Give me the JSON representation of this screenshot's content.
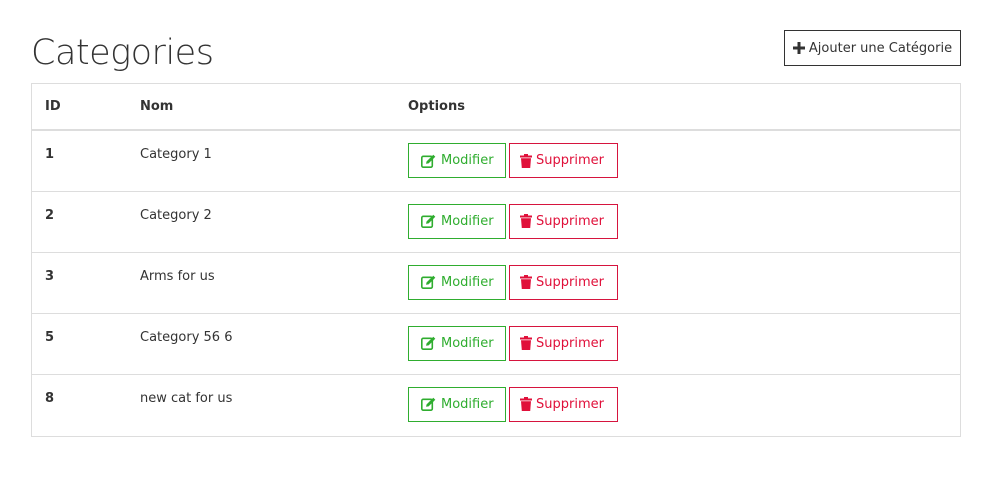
{
  "page": {
    "title": "Categories"
  },
  "toolbar": {
    "add_label": "Ajouter une Catégorie",
    "add_icon": "plus-icon"
  },
  "table": {
    "columns": [
      "ID",
      "Nom",
      "Options"
    ],
    "rows": [
      {
        "id": "1",
        "name": "Category 1"
      },
      {
        "id": "2",
        "name": "Category 2"
      },
      {
        "id": "3",
        "name": "Arms for us"
      },
      {
        "id": "5",
        "name": "Category 56 6"
      },
      {
        "id": "8",
        "name": "new cat for us"
      }
    ],
    "edit_label": "Modifier",
    "edit_icon": "edit-icon",
    "delete_label": "Supprimer",
    "delete_icon": "trash-icon"
  },
  "colors": {
    "edit": "#2fad2f",
    "delete": "#e0103a",
    "border": "#dddddd",
    "text": "#333333"
  }
}
